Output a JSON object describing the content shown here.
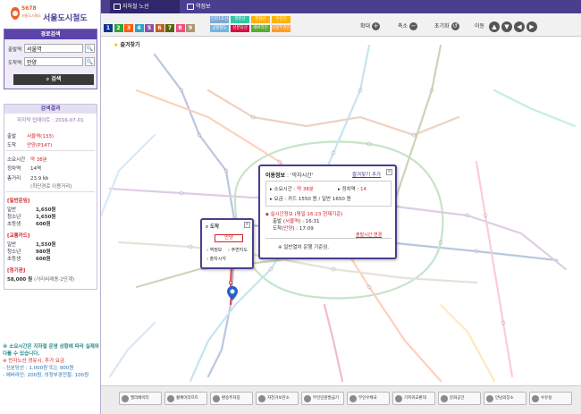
{
  "brand": {
    "small": "5678",
    "small_sub": "서울도시철도",
    "name": "서울도시철도"
  },
  "search": {
    "header": "경로검색",
    "from_label": "출발역",
    "from_value": "서울역",
    "to_label": "도착역",
    "to_value": "안양",
    "find_icon": "🔍",
    "button": "검색"
  },
  "result": {
    "header": "검색결과",
    "updated": "마지막 업데이트 : 2016-07-01",
    "origin_label": "출발",
    "origin_value": "서울역(133)",
    "dest_label": "도착",
    "dest_value": "안양(P147)",
    "time_label": "소요시간",
    "time_value": "약 38분",
    "stops_label": "정차역",
    "stops_value": "14역",
    "distance_label": "총거리",
    "distance_value": "23.9 ㎞",
    "distance_note": "(최단경로 이용거리)",
    "general_header": "[일반운임]",
    "general": [
      {
        "label": "일반",
        "value": "1,650원"
      },
      {
        "label": "청소년",
        "value": "1,650원"
      },
      {
        "label": "초등생",
        "value": "600원"
      }
    ],
    "card_header": "[교통카드]",
    "card": [
      {
        "label": "일반",
        "value": "1,550원"
      },
      {
        "label": "청소년",
        "value": "980원"
      },
      {
        "label": "초등생",
        "value": "600원"
      }
    ],
    "pass_header": "[정기권]",
    "pass_value": "58,000 원",
    "pass_note": "(거리비례용-2단계)"
  },
  "notes": {
    "n1": "※ 소요시간은 지하철 운영 상황에 따라 실제와 다를 수 있습니다.",
    "n2": "※ 민자노선 경유시, 추가 요금",
    "n3a": "- 신분당선 : 1,000원 또는 900원",
    "n3b": "- 에버라인: 200원, 의정부경전철: 100원"
  },
  "tabs": [
    {
      "label": "지하철 노선",
      "active": true
    },
    {
      "label": "역정보",
      "active": false
    }
  ],
  "lines": [
    {
      "num": "1",
      "color": "#0d3692"
    },
    {
      "num": "2",
      "color": "#33a23d"
    },
    {
      "num": "3",
      "color": "#fe5b10"
    },
    {
      "num": "4",
      "color": "#32a1c8"
    },
    {
      "num": "5",
      "color": "#8b50a4"
    },
    {
      "num": "6",
      "color": "#c55c1d"
    },
    {
      "num": "7",
      "color": "#54640d"
    },
    {
      "num": "8",
      "color": "#f14c82"
    },
    {
      "num": "9",
      "color": "#aa9872"
    }
  ],
  "line_names": [
    {
      "label": "인천1호선",
      "color": "#7ca8d5"
    },
    {
      "label": "경춘선",
      "color": "#32c6a6"
    },
    {
      "label": "분당선",
      "color": "#ffb300"
    },
    {
      "label": "수인선",
      "color": "#ffb300"
    },
    {
      "label": "공항철도",
      "color": "#73b6e4"
    },
    {
      "label": "신분당선",
      "color": "#d31145"
    },
    {
      "label": "에버라인",
      "color": "#56ad2d"
    },
    {
      "label": "의정부경전철",
      "color": "#ff9d27"
    }
  ],
  "toolbar": {
    "zoom_in": "확대",
    "zoom_in_icon": "+",
    "zoom_out": "축소",
    "zoom_out_icon": "−",
    "reset": "초기화",
    "reset_icon": "↺",
    "move": "이동",
    "up": "▲",
    "down": "▼",
    "left": "◀",
    "right": "▶"
  },
  "map": {
    "favorite": "즐겨찾기",
    "star_icon": "★",
    "info_popup": {
      "title": "이용정보",
      "subtitle": ": '막차시간'",
      "add_favorite": "즐겨찾기 추가",
      "close_icon": "×",
      "time_label": "▸ 소요시간 : ",
      "time_value": "약 38분",
      "stops_label": "▸ 정차역 : ",
      "stops_value": "14",
      "fare_text": "▸ 요금 : 카드 1550 원 / 일반 1650 원",
      "live_header": "▪ 실시간정보 (평일 16:23 현재기준)",
      "depart_text": "출발 (",
      "depart_station": "서울역",
      "depart_time": ") : 16:31",
      "arrive_text": "도착(",
      "arrive_station": "안양",
      "arrive_time": ") : 17:09",
      "change_time": "출발시간 변경",
      "note": "※ 일반열차 운행 기준임."
    },
    "station_popup": {
      "title": "도착",
      "close_icon": "×",
      "station": "안양",
      "info": "› 역정보",
      "around": "› 주변지도",
      "departure": "› 출차시각"
    }
  },
  "bottom_buttons": [
    "엘리베이터",
    "휠체어리프트",
    "환승주차장",
    "자전거보관소",
    "무인민원발급기",
    "무인우체국",
    "기저귀교환대",
    "문화공간",
    "만남의장소",
    "수유실"
  ]
}
